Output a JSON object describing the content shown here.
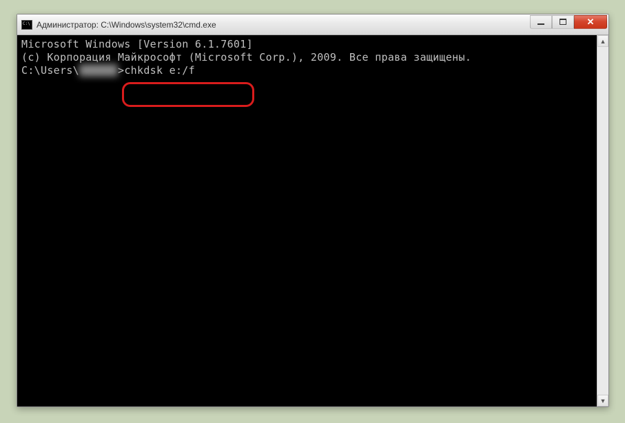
{
  "window": {
    "title": "Администратор: C:\\Windows\\system32\\cmd.exe"
  },
  "console": {
    "line1": "Microsoft Windows [Version 6.1.7601]",
    "line2": "(c) Корпорация Майкрософт (Microsoft Corp.), 2009. Все права защищены.",
    "blank": "",
    "prompt_prefix": "C:\\Users\\",
    "prompt_user_hidden": "██████",
    "prompt_sep": ">",
    "command": "chkdsk e:/f"
  },
  "controls": {
    "minimize": "minimize",
    "maximize": "maximize",
    "close": "close"
  },
  "scroll": {
    "up": "▲",
    "down": "▼"
  }
}
